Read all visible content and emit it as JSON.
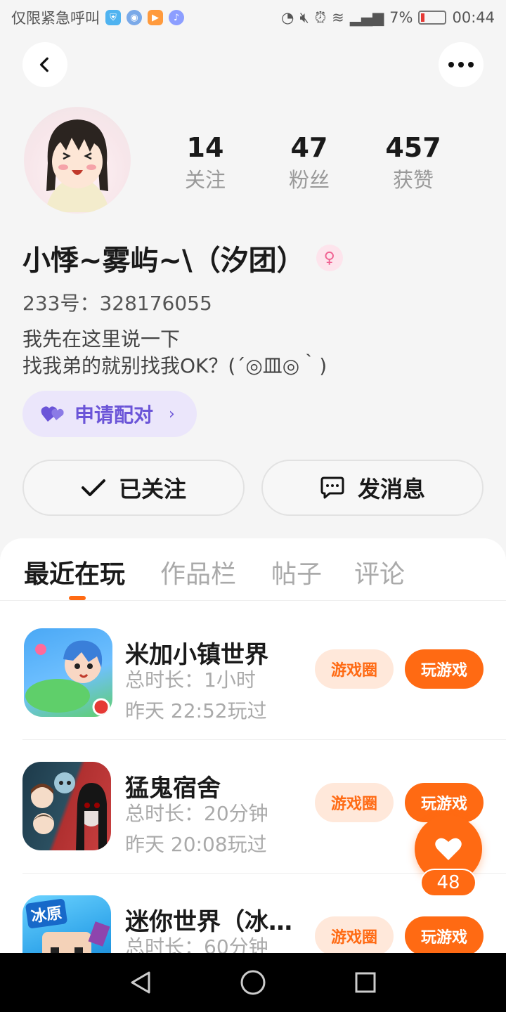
{
  "status_bar": {
    "carrier_text": "仅限紧急呼叫",
    "battery": "7%",
    "time": "00:44"
  },
  "header": {
    "back_icon": "chevron-left-icon",
    "more_icon": "more-horizontal-icon"
  },
  "profile": {
    "stats": [
      {
        "value": "14",
        "label": "关注"
      },
      {
        "value": "47",
        "label": "粉丝"
      },
      {
        "value": "457",
        "label": "获赞"
      }
    ],
    "name": "小悸~雾屿~\\（汐团）",
    "gender_icon": "female-icon",
    "uid": "233号：328176055",
    "bio_line1": "我先在这里说一下",
    "bio_line2": "找我弟的就别找我OK？(´◎皿◎｀)",
    "pair_label": "申请配对",
    "follow_label": "已关注",
    "message_label": "发消息"
  },
  "tabs": [
    {
      "label": "最近在玩",
      "active": true
    },
    {
      "label": "作品栏",
      "active": false
    },
    {
      "label": "帖子",
      "active": false
    },
    {
      "label": "评论",
      "active": false
    }
  ],
  "games": [
    {
      "title": "米加小镇世界",
      "duration": "总时长：1小时",
      "last_played": "昨天 22:52玩过",
      "circle_label": "游戏圈",
      "play_label": "玩游戏"
    },
    {
      "title": "猛鬼宿舍",
      "duration": "总时长：20分钟",
      "last_played": "昨天 20:08玩过",
      "circle_label": "游戏圈",
      "play_label": "玩游戏"
    },
    {
      "title": "迷你世界（冰…",
      "duration": "总时长：60分钟",
      "last_played": "",
      "circle_label": "游戏圈",
      "play_label": "玩游戏",
      "icon_text": "冰原"
    }
  ],
  "like_fab": {
    "count": "48",
    "icon": "heart-icon"
  },
  "colors": {
    "accent": "#ff6a13",
    "pair": "#6b55d8"
  }
}
